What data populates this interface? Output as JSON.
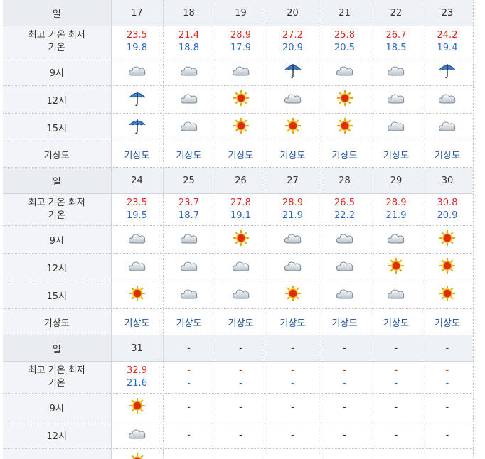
{
  "labels": {
    "day": "일",
    "temp_line1": "최고 기온 최저",
    "temp_line2": "기온",
    "t9": "9시",
    "t12": "12시",
    "t15": "15시",
    "map": "기상도"
  },
  "colors": {
    "high": "#e0271f",
    "low": "#2c66c8",
    "link": "#1a4f9c",
    "header_bg": "#eef1f5"
  },
  "weeks": [
    {
      "days": [
        {
          "day": "17",
          "high": "23.5",
          "low": "19.8",
          "w9": "cloud-icon",
          "w12": "umbrella-icon",
          "w15": "umbrella-icon",
          "map": "기상도"
        },
        {
          "day": "18",
          "high": "21.4",
          "low": "18.8",
          "w9": "cloud-icon",
          "w12": "cloud-icon",
          "w15": "cloud-icon",
          "map": "기상도"
        },
        {
          "day": "19",
          "high": "28.9",
          "low": "17.9",
          "w9": "cloud-icon",
          "w12": "sun-icon",
          "w15": "sun-icon",
          "map": "기상도"
        },
        {
          "day": "20",
          "high": "27.2",
          "low": "20.9",
          "w9": "umbrella-icon",
          "w12": "cloud-icon",
          "w15": "sun-icon",
          "map": "기상도"
        },
        {
          "day": "21",
          "high": "25.8",
          "low": "20.5",
          "w9": "cloud-icon",
          "w12": "sun-icon",
          "w15": "sun-icon",
          "map": "기상도"
        },
        {
          "day": "22",
          "high": "26.7",
          "low": "18.5",
          "w9": "cloud-icon",
          "w12": "cloud-icon",
          "w15": "cloud-icon",
          "map": "기상도"
        },
        {
          "day": "23",
          "high": "24.2",
          "low": "19.4",
          "w9": "umbrella-icon",
          "w12": "cloud-icon",
          "w15": "cloud-icon",
          "map": "기상도"
        }
      ]
    },
    {
      "days": [
        {
          "day": "24",
          "high": "23.5",
          "low": "19.5",
          "w9": "cloud-icon",
          "w12": "cloud-icon",
          "w15": "sun-icon",
          "map": "기상도"
        },
        {
          "day": "25",
          "high": "23.7",
          "low": "18.7",
          "w9": "cloud-icon",
          "w12": "cloud-icon",
          "w15": "cloud-icon",
          "map": "기상도"
        },
        {
          "day": "26",
          "high": "27.8",
          "low": "19.1",
          "w9": "sun-icon",
          "w12": "cloud-icon",
          "w15": "cloud-icon",
          "map": "기상도"
        },
        {
          "day": "27",
          "high": "28.9",
          "low": "21.9",
          "w9": "cloud-icon",
          "w12": "cloud-icon",
          "w15": "sun-icon",
          "map": "기상도"
        },
        {
          "day": "28",
          "high": "26.5",
          "low": "22.2",
          "w9": "cloud-icon",
          "w12": "cloud-icon",
          "w15": "cloud-icon",
          "map": "기상도"
        },
        {
          "day": "29",
          "high": "28.9",
          "low": "21.9",
          "w9": "cloud-icon",
          "w12": "sun-icon",
          "w15": "cloud-icon",
          "map": "기상도"
        },
        {
          "day": "30",
          "high": "30.8",
          "low": "20.9",
          "w9": "sun-icon",
          "w12": "sun-icon",
          "w15": "sun-icon",
          "map": "기상도"
        }
      ]
    },
    {
      "days": [
        {
          "day": "31",
          "high": "32.9",
          "low": "21.6",
          "w9": "sun-icon",
          "w12": "cloud-icon",
          "w15": "sun-icon",
          "map": ""
        },
        {
          "day": "-",
          "high": "-",
          "low": "-",
          "w9": "-",
          "w12": "-",
          "w15": "-",
          "map": ""
        },
        {
          "day": "-",
          "high": "-",
          "low": "-",
          "w9": "-",
          "w12": "-",
          "w15": "-",
          "map": ""
        },
        {
          "day": "-",
          "high": "-",
          "low": "-",
          "w9": "-",
          "w12": "-",
          "w15": "-",
          "map": ""
        },
        {
          "day": "-",
          "high": "-",
          "low": "-",
          "w9": "-",
          "w12": "-",
          "w15": "-",
          "map": ""
        },
        {
          "day": "-",
          "high": "-",
          "low": "-",
          "w9": "-",
          "w12": "-",
          "w15": "-",
          "map": ""
        },
        {
          "day": "-",
          "high": "-",
          "low": "-",
          "w9": "-",
          "w12": "-",
          "w15": "-",
          "map": ""
        }
      ]
    }
  ]
}
